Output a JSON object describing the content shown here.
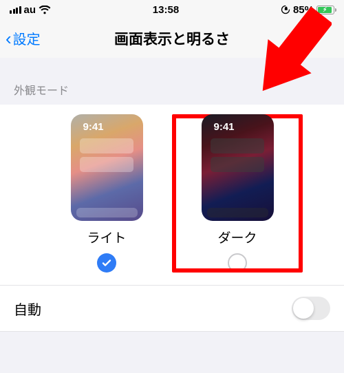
{
  "status": {
    "carrier": "au",
    "time": "13:58",
    "battery_pct": "85%"
  },
  "nav": {
    "back_label": "設定",
    "title": "画面表示と明るさ"
  },
  "appearance": {
    "section_header": "外観モード",
    "modes": {
      "light": {
        "label": "ライト",
        "preview_time": "9:41",
        "selected": true
      },
      "dark": {
        "label": "ダーク",
        "preview_time": "9:41",
        "selected": false,
        "highlighted": true
      }
    }
  },
  "auto": {
    "label": "自動",
    "enabled": false
  },
  "annotation": {
    "arrow_color": "#ff0000",
    "highlight_color": "#ff0000"
  }
}
